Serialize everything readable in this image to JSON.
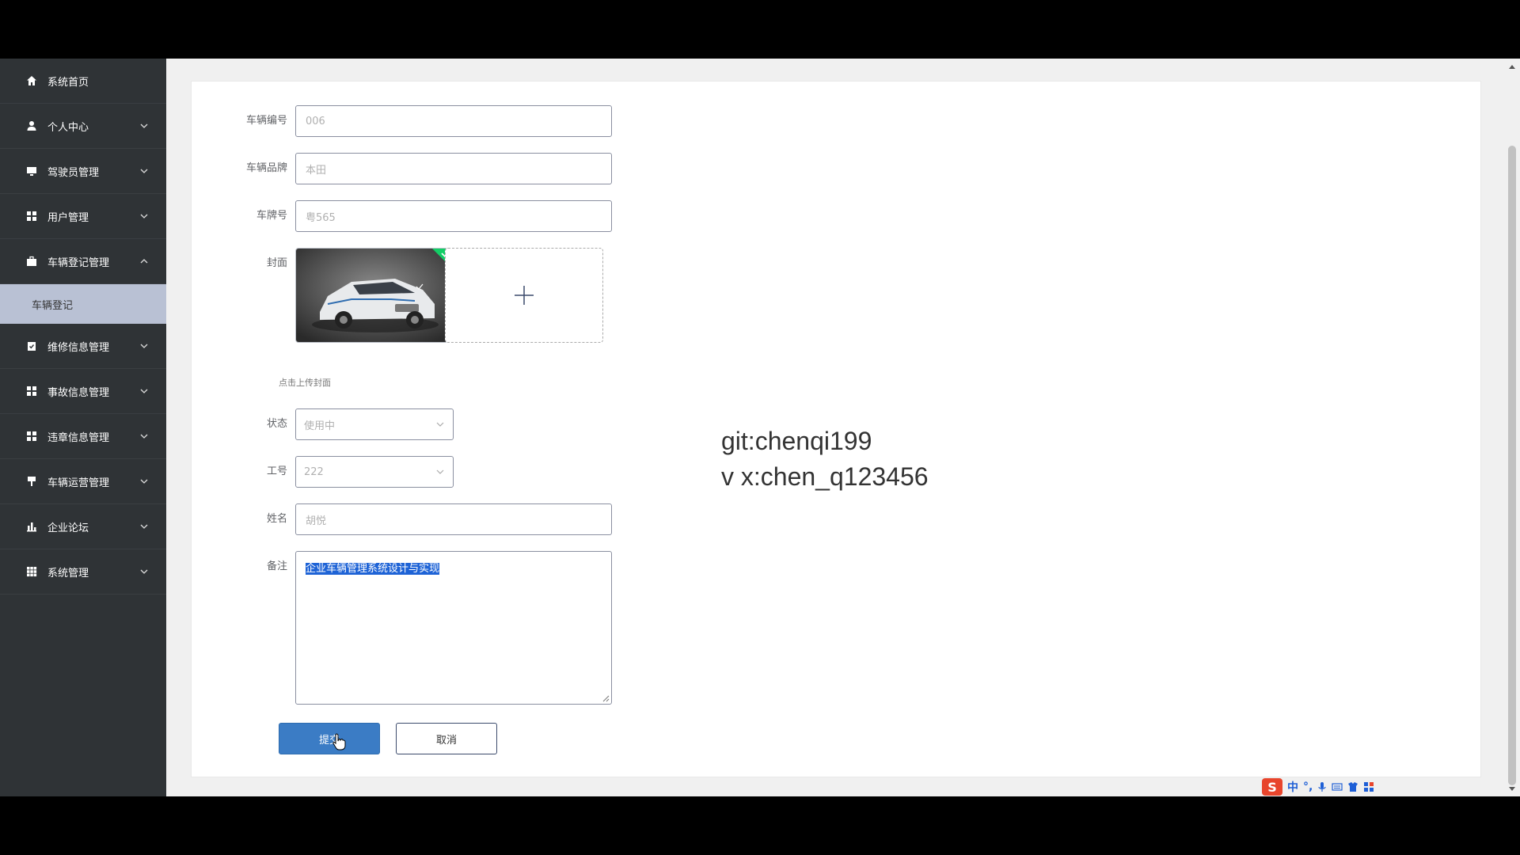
{
  "sidebar": {
    "items": [
      {
        "label": "系统首页",
        "icon": "home-icon"
      },
      {
        "label": "个人中心",
        "icon": "user-icon"
      },
      {
        "label": "驾驶员管理",
        "icon": "monitor-icon"
      },
      {
        "label": "用户管理",
        "icon": "grid-icon"
      },
      {
        "label": "车辆登记管理",
        "icon": "briefcase-icon"
      },
      {
        "label": "维修信息管理",
        "icon": "clipboard-icon"
      },
      {
        "label": "事故信息管理",
        "icon": "grid-icon"
      },
      {
        "label": "违章信息管理",
        "icon": "grid-icon"
      },
      {
        "label": "车辆运营管理",
        "icon": "flag-icon"
      },
      {
        "label": "企业论坛",
        "icon": "bar-chart-icon"
      },
      {
        "label": "系统管理",
        "icon": "table-icon"
      }
    ],
    "sub_item": "车辆登记"
  },
  "form": {
    "vehicle_no": {
      "label": "车辆编号",
      "value": "006"
    },
    "brand": {
      "label": "车辆品牌",
      "value": "本田"
    },
    "plate": {
      "label": "车牌号",
      "value": "粤565"
    },
    "cover": {
      "label": "封面",
      "tip": "点击上传封面",
      "add_icon": "plus-icon"
    },
    "status": {
      "label": "状态",
      "value": "使用中"
    },
    "job_no": {
      "label": "工号",
      "value": "222"
    },
    "name": {
      "label": "姓名",
      "value": "胡悦"
    },
    "remark": {
      "label": "备注",
      "value": "企业车辆管理系统设计与实现"
    },
    "submit_label": "提交",
    "cancel_label": "取消"
  },
  "watermark": {
    "line1": "git:chenqi199",
    "line2": "v x:chen_q123456"
  },
  "ime": {
    "logo": "S",
    "lang": "中",
    "punct": "°,"
  }
}
